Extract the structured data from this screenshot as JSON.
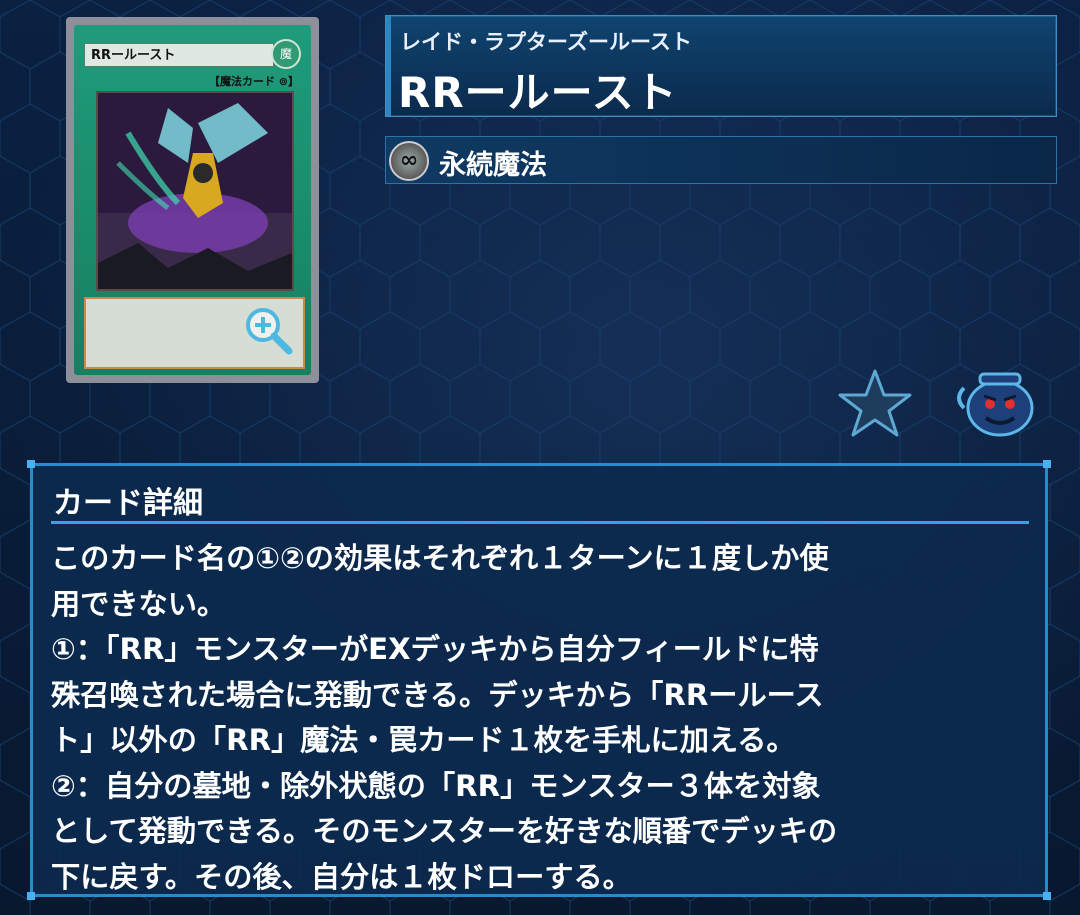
{
  "card": {
    "art_name": "RRールースト",
    "attribute_glyph": "魔",
    "art_type": "【魔法カード ⊚】",
    "zoom_icon": "zoom-in-icon"
  },
  "header": {
    "ruby": "レイド・ラプターズールースト",
    "title": "RRールースト"
  },
  "type": {
    "icon": "continuous-icon",
    "icon_glyph": "∞",
    "label": "永続魔法"
  },
  "actions": {
    "favorite_icon": "star-icon",
    "pot_icon": "pot-of-greed-icon"
  },
  "details": {
    "title": "カード詳細",
    "text": "このカード名の①②の効果はそれぞれ１ターンに１度しか使\n用できない。\n①：「RR」モンスターがEXデッキから自分フィールドに特\n殊召喚された場合に発動できる。デッキから「RRールース\nト」以外の「RR」魔法・罠カード１枚を手札に加える。\n②：自分の墓地・除外状態の「RR」モンスター３体を対象\nとして発動できる。そのモンスターを好きな順番でデッキの\n下に戻す。その後、自分は１枚ドローする。"
  },
  "colors": {
    "panel_border": "#2a8bcc",
    "card_green": "#1f9c7b",
    "background": "#0a1a33"
  }
}
